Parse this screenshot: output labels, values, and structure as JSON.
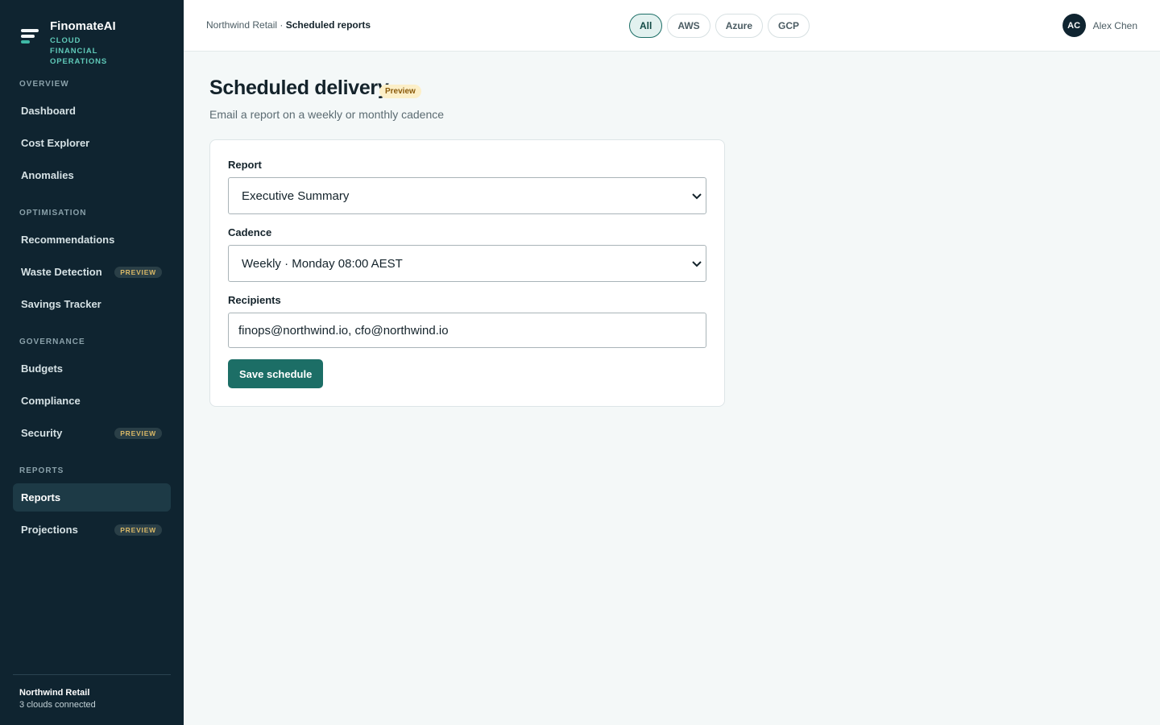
{
  "brand": {
    "name": "FinomateAI",
    "tagline": "CLOUD FINANCIAL OPERATIONS"
  },
  "sidebar": {
    "sections": [
      {
        "title": "OVERVIEW",
        "items": [
          {
            "label": "Dashboard"
          },
          {
            "label": "Cost Explorer"
          },
          {
            "label": "Anomalies"
          }
        ]
      },
      {
        "title": "OPTIMISATION",
        "items": [
          {
            "label": "Recommendations"
          },
          {
            "label": "Waste Detection",
            "badge": "PREVIEW"
          },
          {
            "label": "Savings Tracker"
          }
        ]
      },
      {
        "title": "GOVERNANCE",
        "items": [
          {
            "label": "Budgets"
          },
          {
            "label": "Compliance"
          },
          {
            "label": "Security",
            "badge": "PREVIEW"
          }
        ]
      },
      {
        "title": "REPORTS",
        "items": [
          {
            "label": "Reports",
            "active": true
          },
          {
            "label": "Projections",
            "badge": "PREVIEW"
          }
        ]
      }
    ],
    "footer": {
      "org": "Northwind Retail",
      "status": "3 clouds connected"
    }
  },
  "topbar": {
    "breadcrumb_parent": "Northwind Retail",
    "breadcrumb_sep": " · ",
    "breadcrumb_current": "Scheduled reports",
    "cloud_filters": [
      "All",
      "AWS",
      "Azure",
      "GCP"
    ],
    "active_filter": "All",
    "user": {
      "initials": "AC",
      "name": "Alex Chen"
    }
  },
  "main": {
    "title": "Scheduled delivery",
    "title_badge": "Preview",
    "subtitle": "Email a report on a weekly or monthly cadence",
    "form": {
      "report_label": "Report",
      "report_value": "Executive Summary",
      "cadence_label": "Cadence",
      "cadence_value": "Weekly · Monday 08:00 AEST",
      "recipients_label": "Recipients",
      "recipients_value": "finops@northwind.io, cfo@northwind.io",
      "save_label": "Save schedule"
    }
  },
  "colors": {
    "sidebar_bg": "#0f2430",
    "accent": "#1c6e66",
    "preview_badge": "#d9b866"
  }
}
